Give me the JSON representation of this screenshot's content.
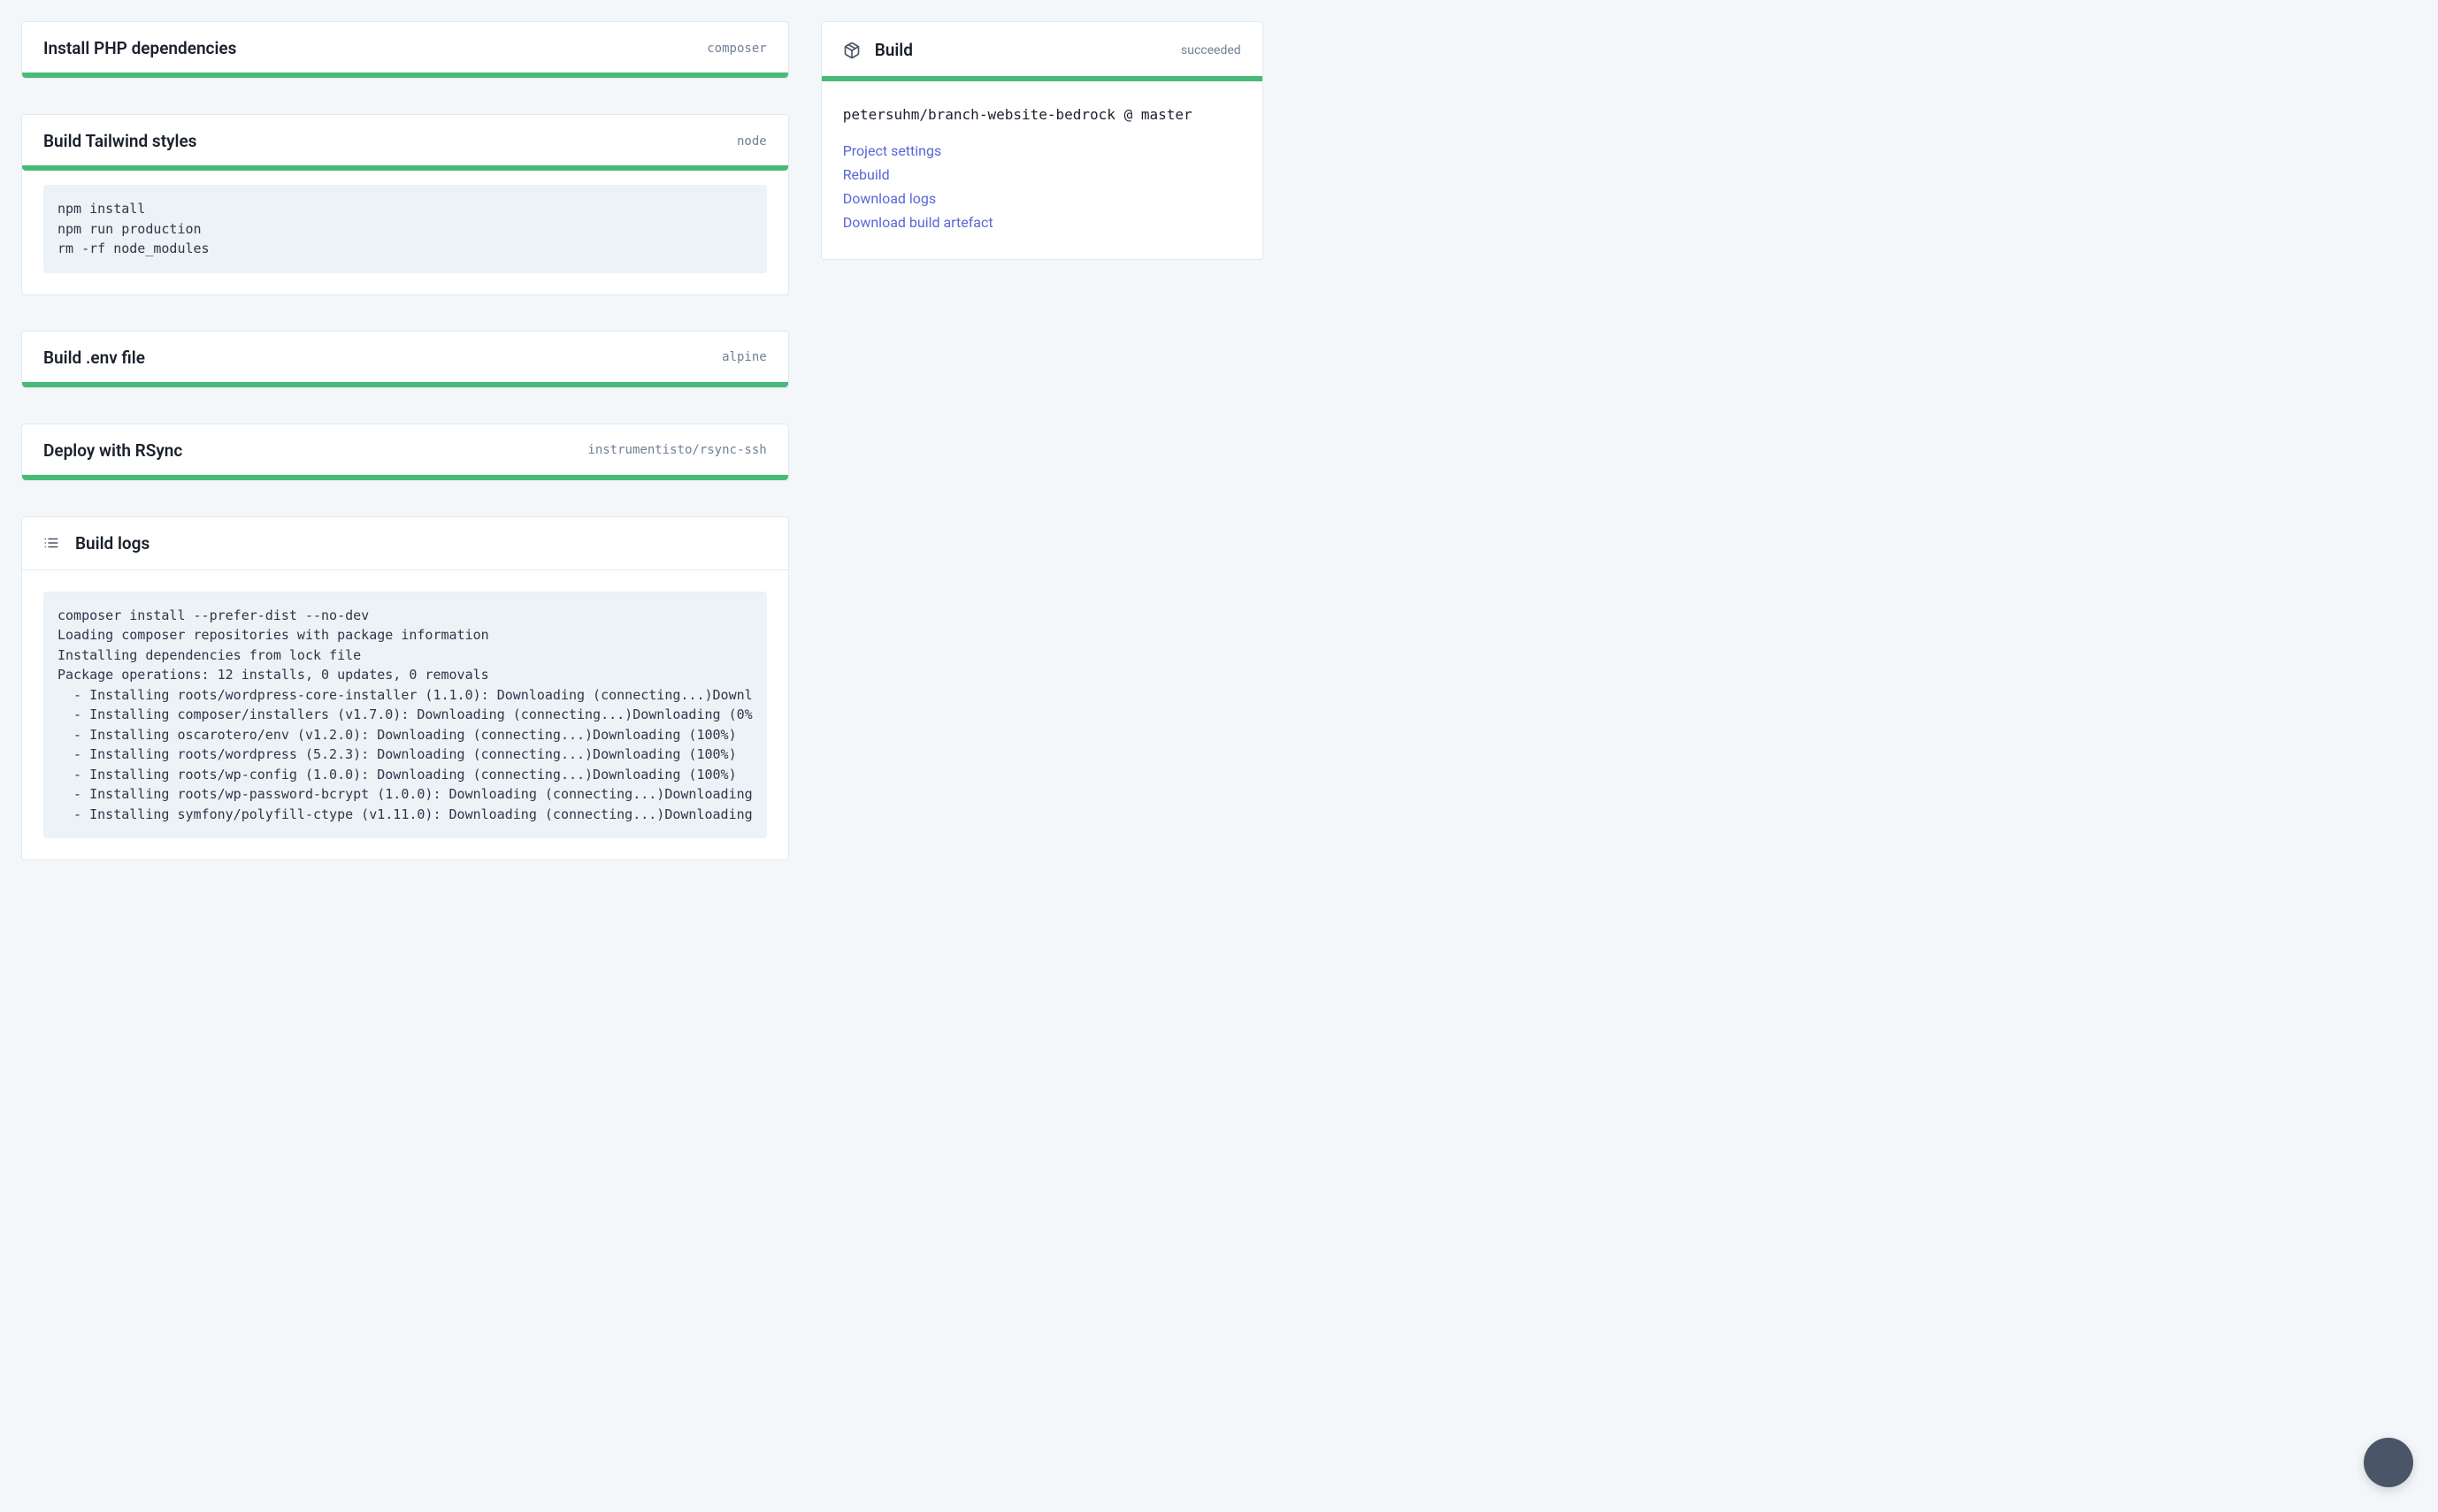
{
  "steps": [
    {
      "title": "Install PHP dependencies",
      "tag": "composer"
    },
    {
      "title": "Build Tailwind styles",
      "tag": "node",
      "code": "npm install\nnpm run production\nrm -rf node_modules"
    },
    {
      "title": "Build .env file",
      "tag": "alpine"
    },
    {
      "title": "Deploy with RSync",
      "tag": "instrumentisto/rsync-ssh"
    }
  ],
  "logs": {
    "title": "Build logs",
    "content": "composer install --prefer-dist --no-dev\nLoading composer repositories with package information\nInstalling dependencies from lock file\nPackage operations: 12 installs, 0 updates, 0 removals\n  - Installing roots/wordpress-core-installer (1.1.0): Downloading (connecting...)Downl\n  - Installing composer/installers (v1.7.0): Downloading (connecting...)Downloading (0%\n  - Installing oscarotero/env (v1.2.0): Downloading (connecting...)Downloading (100%)\n  - Installing roots/wordpress (5.2.3): Downloading (connecting...)Downloading (100%)\n  - Installing roots/wp-config (1.0.0): Downloading (connecting...)Downloading (100%)\n  - Installing roots/wp-password-bcrypt (1.0.0): Downloading (connecting...)Downloading\n  - Installing symfony/polyfill-ctype (v1.11.0): Downloading (connecting...)Downloading"
  },
  "sidebar": {
    "title": "Build",
    "status": "succeeded",
    "repo": "petersuhm/branch-website-bedrock @ master",
    "links": {
      "project_settings": "Project settings",
      "rebuild": "Rebuild",
      "download_logs": "Download logs",
      "download_artefact": "Download build artefact"
    }
  }
}
